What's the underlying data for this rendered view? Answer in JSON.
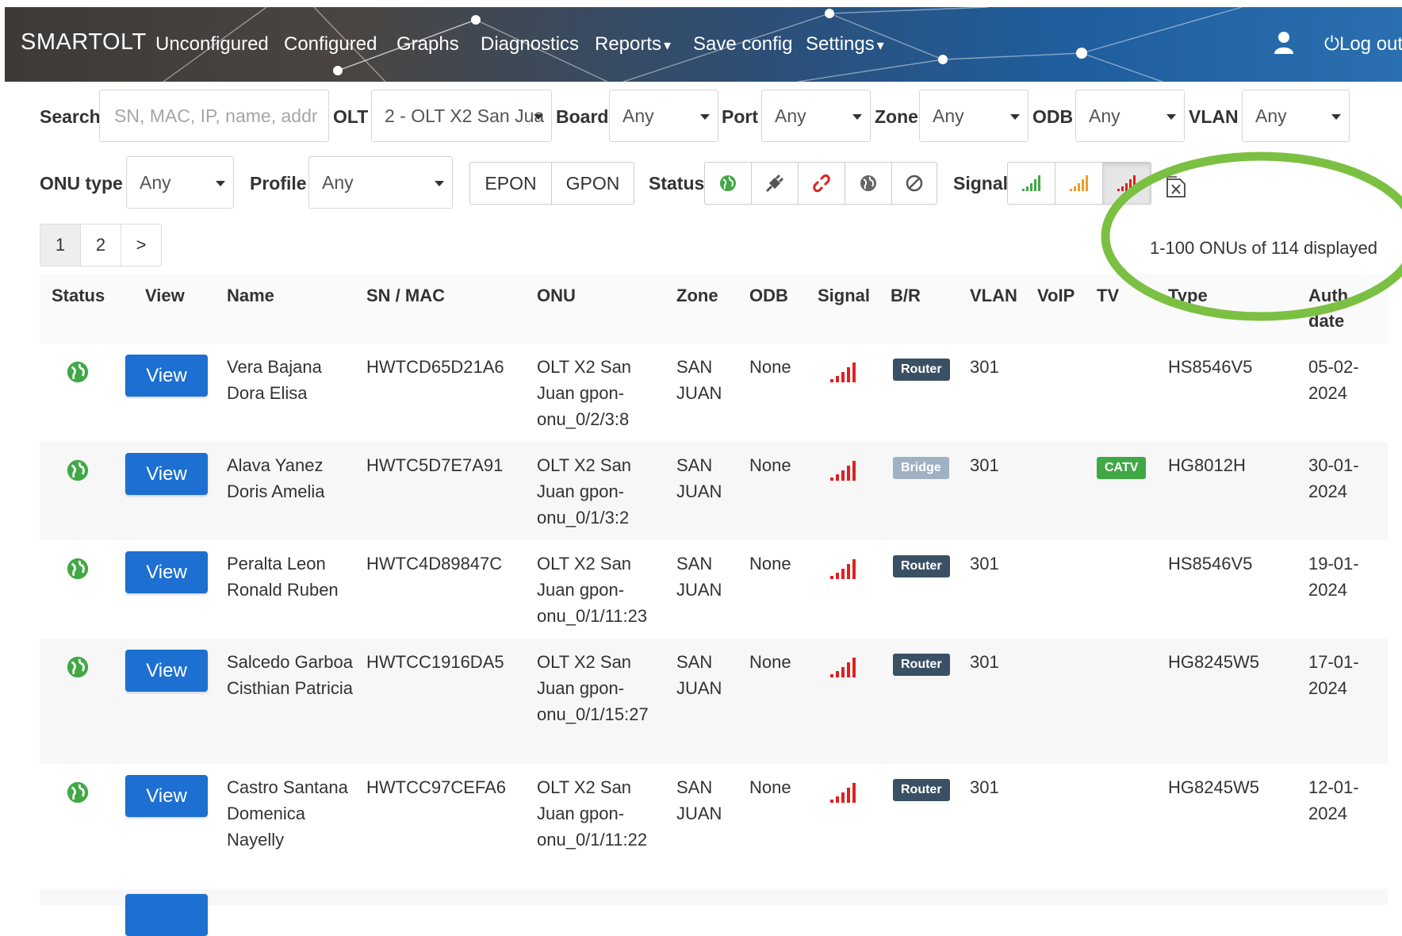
{
  "nav": {
    "brand": "SMARTOLT",
    "items": [
      "Unconfigured",
      "Configured",
      "Graphs",
      "Diagnostics",
      "Reports",
      "Save config",
      "Settings"
    ],
    "logout": "Log out"
  },
  "filters": {
    "search_label": "Search",
    "search_placeholder": "SN, MAC, IP, name, addr",
    "olt_label": "OLT",
    "olt_value": "2 - OLT X2 San Jua",
    "board_label": "Board",
    "board_value": "Any",
    "port_label": "Port",
    "port_value": "Any",
    "zone_label": "Zone",
    "zone_value": "Any",
    "odb_label": "ODB",
    "odb_value": "Any",
    "vlan_label": "VLAN",
    "vlan_value": "Any",
    "onu_type_label": "ONU type",
    "onu_type_value": "Any",
    "profile_label": "Profile",
    "profile_value": "Any",
    "epon": "EPON",
    "gpon": "GPON",
    "status_label": "Status",
    "signal_label": "Signal"
  },
  "pagination": {
    "pages": [
      "1",
      "2"
    ],
    "next": ">"
  },
  "summary": "1-100 ONUs of 114 displayed",
  "table": {
    "headers": [
      "Status",
      "View",
      "Name",
      "SN / MAC",
      "ONU",
      "Zone",
      "ODB",
      "Signal",
      "B/R",
      "VLAN",
      "VoIP",
      "TV",
      "Type",
      "Auth date"
    ],
    "view_label": "View",
    "rows": [
      {
        "name": "Vera Bajana Dora Elisa",
        "sn": "HWTCD65D21A6",
        "onu": "OLT X2 San Juan gpon-onu_0/2/3:8",
        "zone": "SAN JUAN",
        "odb": "None",
        "br": "Router",
        "vlan": "301",
        "tv": "",
        "type": "HS8546V5",
        "auth": "05-02-2024"
      },
      {
        "name": "Alava Yanez Doris Amelia",
        "sn": "HWTC5D7E7A91",
        "onu": "OLT X2 San Juan gpon-onu_0/1/3:2",
        "zone": "SAN JUAN",
        "odb": "None",
        "br": "Bridge",
        "vlan": "301",
        "tv": "CATV",
        "type": "HG8012H",
        "auth": "30-01-2024"
      },
      {
        "name": "Peralta Leon Ronald Ruben",
        "sn": "HWTC4D89847C",
        "onu": "OLT X2 San Juan gpon-onu_0/1/11:23",
        "zone": "SAN JUAN",
        "odb": "None",
        "br": "Router",
        "vlan": "301",
        "tv": "",
        "type": "HS8546V5",
        "auth": "19-01-2024"
      },
      {
        "name": "Salcedo Garboa Cisthian Patricia",
        "sn": "HWTCC1916DA5",
        "onu": "OLT X2 San Juan gpon-onu_0/1/15:27",
        "zone": "SAN JUAN",
        "odb": "None",
        "br": "Router",
        "vlan": "301",
        "tv": "",
        "type": "HG8245W5",
        "auth": "17-01-2024"
      },
      {
        "name": "Castro Santana Domenica Nayelly",
        "sn": "HWTCC97CEFA6",
        "onu": "OLT X2 San Juan gpon-onu_0/1/11:22",
        "zone": "SAN JUAN",
        "odb": "None",
        "br": "Router",
        "vlan": "301",
        "tv": "",
        "type": "HG8245W5",
        "auth": "12-01-2024"
      }
    ]
  },
  "colors": {
    "view_button": "#1d6fd1",
    "router_badge": "#3a5064",
    "bridge_badge": "#9fb1c2",
    "catv_badge": "#41a846",
    "signal_good": "#41a846",
    "signal_warning": "#f0a020",
    "signal_critical": "#e02020",
    "annotation_circle": "#7bc043"
  }
}
